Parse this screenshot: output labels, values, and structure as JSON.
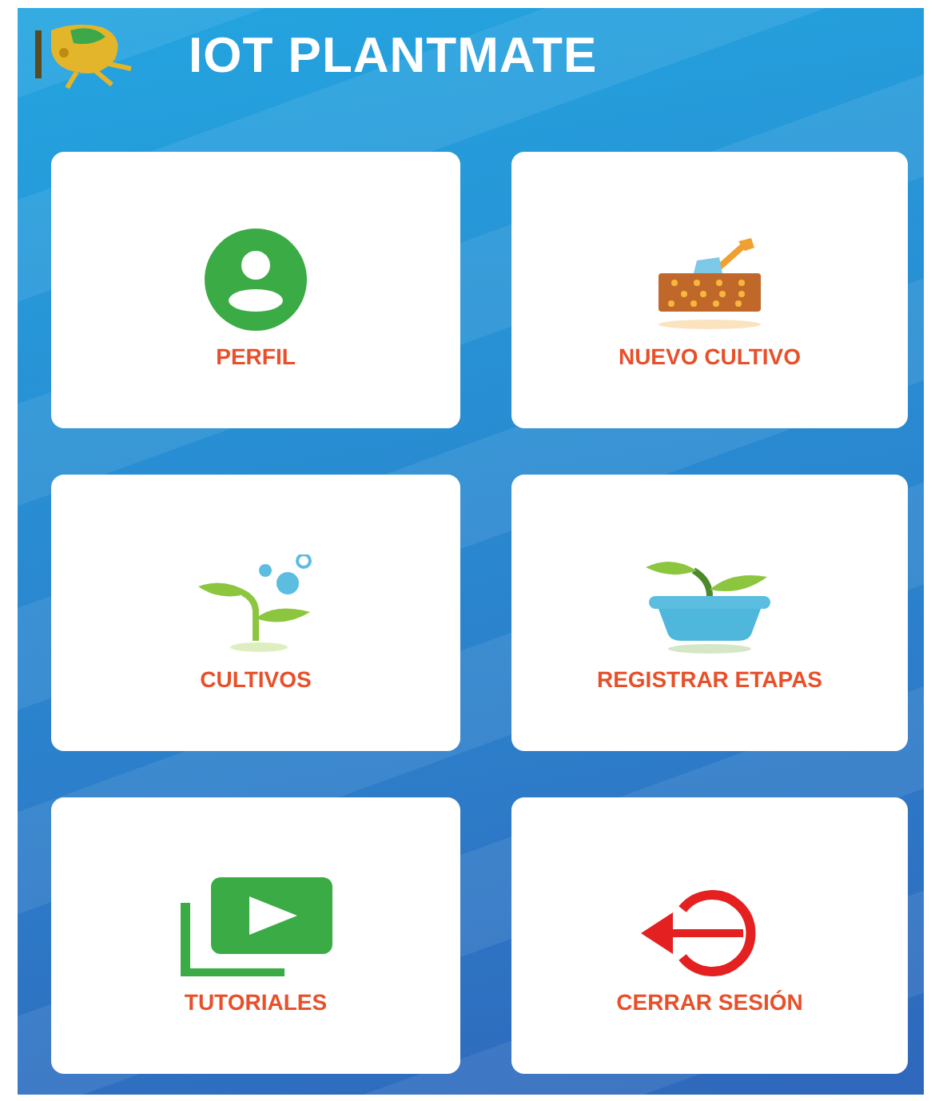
{
  "header": {
    "title": "IOT PLANTMATE"
  },
  "menu": [
    {
      "label": "PERFIL",
      "kind": "profile"
    },
    {
      "label": "NUEVO CULTIVO",
      "kind": "garden"
    },
    {
      "label": "CULTIVOS",
      "kind": "sprout"
    },
    {
      "label": "REGISTRAR ETAPAS",
      "kind": "pot"
    },
    {
      "label": "TUTORIALES",
      "kind": "video"
    },
    {
      "label": "CERRAR SESIÓN",
      "kind": "logout"
    }
  ]
}
